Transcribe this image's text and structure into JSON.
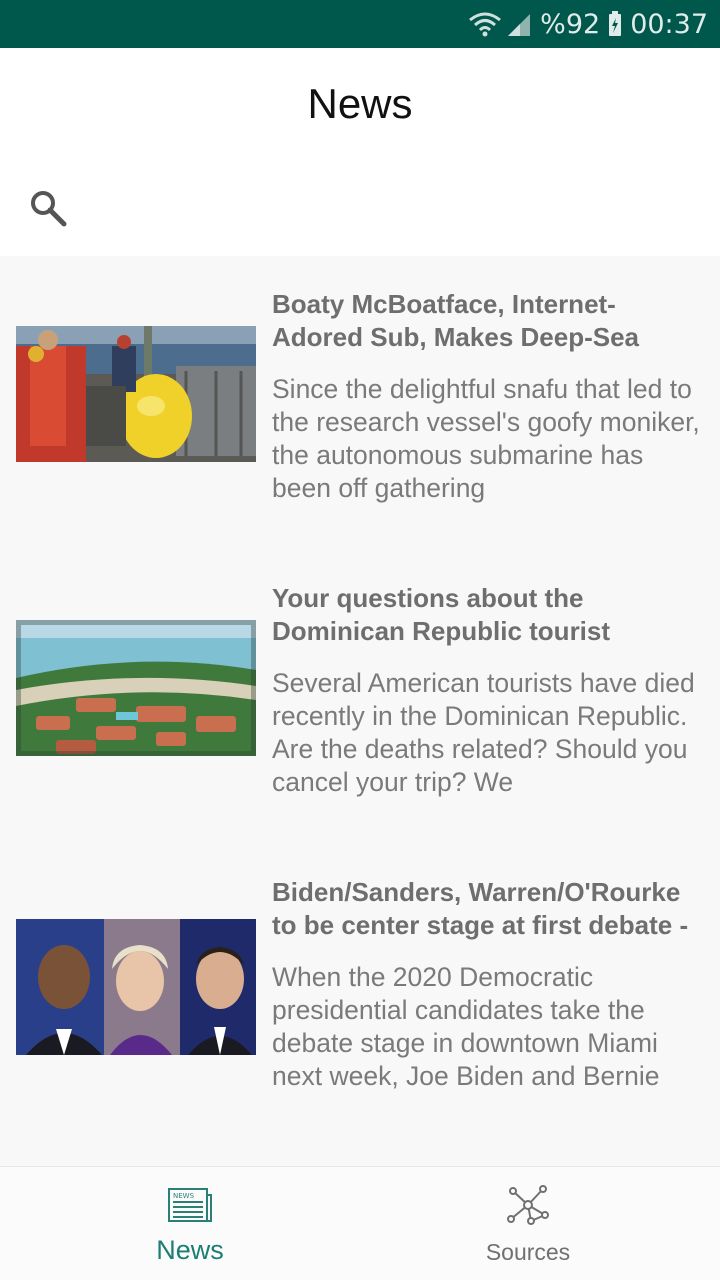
{
  "status_bar": {
    "battery": "%92",
    "time": "00:37",
    "icons": [
      "wifi-icon",
      "signal-icon",
      "battery-charging-icon"
    ],
    "background": "#00574b"
  },
  "header": {
    "title": "News"
  },
  "search": {
    "icon": "search-icon",
    "value": "",
    "placeholder": ""
  },
  "articles": [
    {
      "title": "Boaty McBoatface, Internet-Adored Sub, Makes Deep-Sea",
      "description": "Since the delightful snafu that led to the research vessel's goofy moniker, the autonomous submarine has been off gathering",
      "image": "submarine-on-ship-deck-photo"
    },
    {
      "title": "Your questions about the Dominican Republic tourist",
      "description": "Several American tourists have died recently in the Dominican Republic. Are the deaths related? Should you cancel your trip? We",
      "image": "dominican-resort-aerial-photo"
    },
    {
      "title": "Biden/Sanders, Warren/O'Rourke to be center stage at first debate -",
      "description": "When the 2020 Democratic presidential candidates take the debate stage in downtown Miami next week, Joe Biden and Bernie",
      "image": "candidates-portraits-photo"
    }
  ],
  "bottom_nav": {
    "items": [
      {
        "label": "News",
        "icon": "newspaper-icon",
        "active": true
      },
      {
        "label": "Sources",
        "icon": "network-icon",
        "active": false
      }
    ],
    "active_color": "#1b7e73",
    "inactive_color": "#707070"
  }
}
